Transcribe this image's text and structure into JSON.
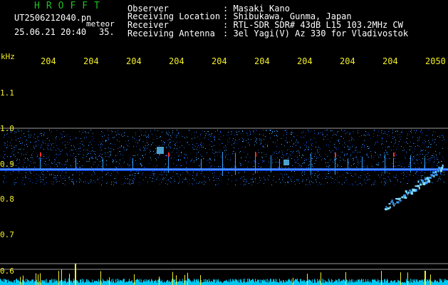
{
  "header": {
    "brand": "HROFFT",
    "filename": "UT2506212040.pn",
    "mode": "meteor",
    "datetime": "25.06.21 20:40",
    "count": "35.",
    "fields": [
      {
        "label": "Observer",
        "value": ": Masaki Kano"
      },
      {
        "label": "Receiving Location",
        "value": ": Shibukawa, Gunma, Japan"
      },
      {
        "label": "Receiver",
        "value": ": RTL-SDR SDR# 43dB L15 103.2MHz CW"
      },
      {
        "label": "Receiving Antenna",
        "value": ": 3el Yagi(V) Az 330 for Vladivostok"
      }
    ]
  },
  "axes": {
    "unit": "kHz",
    "y_ticks": [
      "1.1",
      "1.0",
      "0.9",
      "0.8",
      "0.7",
      "0.6"
    ],
    "x_ticks": [
      "204",
      "204",
      "204",
      "204",
      "204",
      "204",
      "204",
      "204",
      "204",
      "2050"
    ]
  },
  "colors": {
    "brand": "#1ec21e",
    "label": "#ffffff",
    "tick": "#f2ee2a",
    "signal_high": "#ff3030",
    "signal_mid": "#30a0ff",
    "noise_bar": "#00c8f0",
    "noise_peak": "#f2ee2a"
  }
}
